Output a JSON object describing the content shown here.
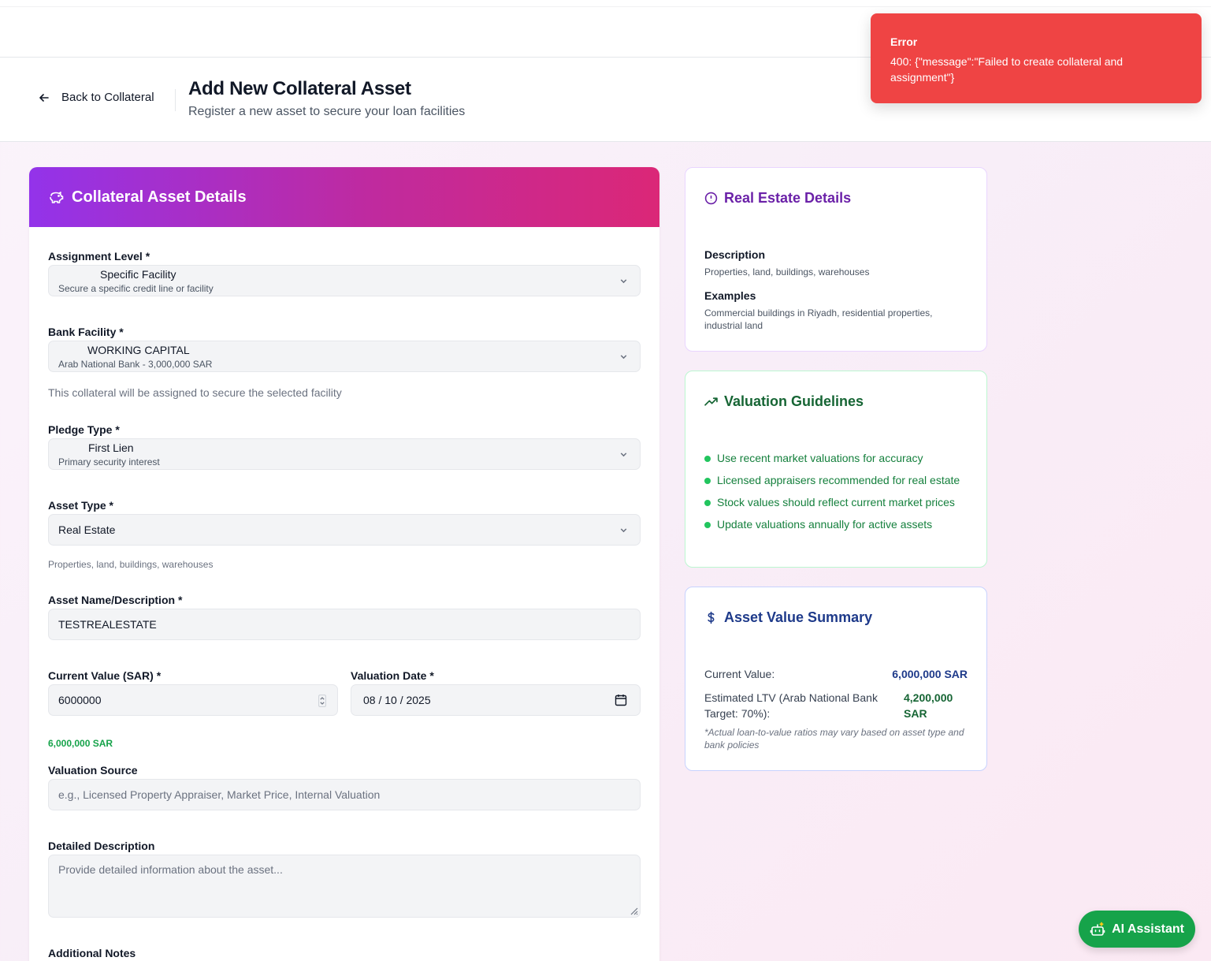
{
  "header": {
    "back_label": "Back to Collateral",
    "title": "Add New Collateral Asset",
    "subtitle": "Register a new asset to secure your loan facilities"
  },
  "toast": {
    "title": "Error",
    "message": "400: {\"message\":\"Failed to create collateral and assignment\"}"
  },
  "form": {
    "title": "Collateral Asset Details",
    "assignment_level": {
      "label": "Assignment Level *",
      "value": "Specific Facility",
      "sub": "Secure a specific credit line or facility"
    },
    "bank_facility": {
      "label": "Bank Facility *",
      "value": "WORKING CAPITAL",
      "sub": "Arab National Bank - 3,000,000 SAR",
      "help": "This collateral will be assigned to secure the selected facility"
    },
    "pledge_type": {
      "label": "Pledge Type *",
      "value": "First Lien",
      "sub": "Primary security interest"
    },
    "asset_type": {
      "label": "Asset Type *",
      "value": "Real Estate",
      "help": "Properties, land, buildings, warehouses"
    },
    "asset_name": {
      "label": "Asset Name/Description *",
      "value": "TESTREALESTATE"
    },
    "current_value": {
      "label": "Current Value (SAR) *",
      "value": "6000000",
      "formatted": "6,000,000 SAR"
    },
    "valuation_date": {
      "label": "Valuation Date *",
      "value": "08 / 10 / 2025"
    },
    "valuation_source": {
      "label": "Valuation Source",
      "placeholder": "e.g., Licensed Property Appraiser, Market Price, Internal Valuation"
    },
    "detailed_description": {
      "label": "Detailed Description",
      "placeholder": "Provide detailed information about the asset..."
    },
    "additional_notes": {
      "label": "Additional Notes"
    }
  },
  "real_estate": {
    "title": "Real Estate Details",
    "description_label": "Description",
    "description": "Properties, land, buildings, warehouses",
    "examples_label": "Examples",
    "examples": "Commercial buildings in Riyadh, residential properties, industrial land"
  },
  "guidelines": {
    "title": "Valuation Guidelines",
    "items": [
      "Use recent market valuations for accuracy",
      "Licensed appraisers recommended for real estate",
      "Stock values should reflect current market prices",
      "Update valuations annually for active assets"
    ]
  },
  "summary": {
    "title": "Asset Value Summary",
    "current_label": "Current Value:",
    "current_value": "6,000,000 SAR",
    "ltv_label": "Estimated LTV (Arab National Bank Target: 70%):",
    "ltv_value": "4,200,000 SAR",
    "note": "*Actual loan-to-value ratios may vary based on asset type and bank policies"
  },
  "ai_button": {
    "label": "AI Assistant"
  },
  "colors": {
    "error": "#ef4444",
    "gradient_start": "#9333ea",
    "gradient_end": "#db2777",
    "success": "#16a34a",
    "summary_value": "#1e3a8a"
  }
}
